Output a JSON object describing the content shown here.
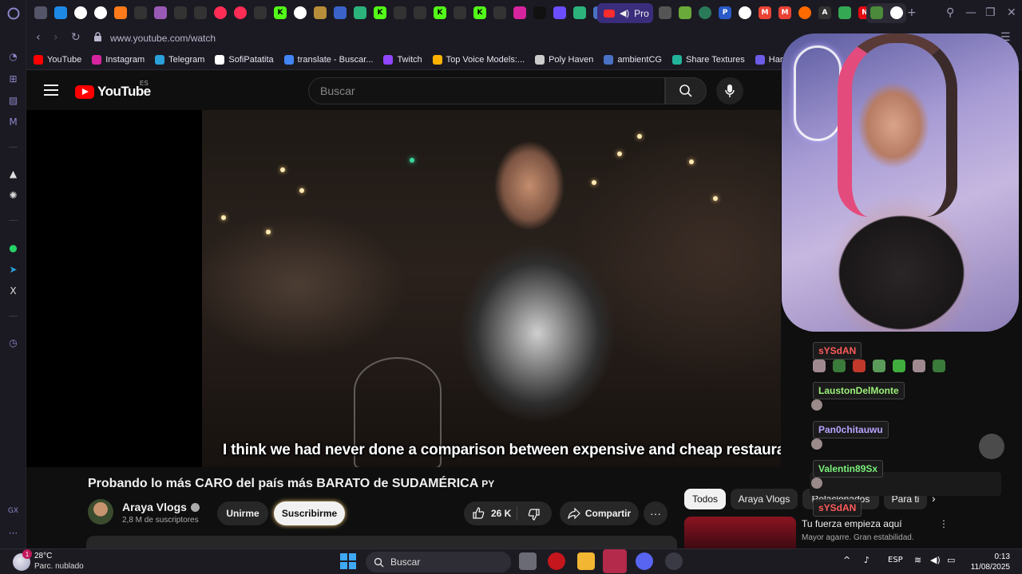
{
  "browser": {
    "url": "www.youtube.com/watch",
    "pro_tab_label": "Pro"
  },
  "bookmarks": [
    {
      "label": "YouTube",
      "color": "#ff0000"
    },
    {
      "label": "Instagram",
      "color": "#d6249f"
    },
    {
      "label": "Telegram",
      "color": "#2aa1da"
    },
    {
      "label": "SofiPatatita",
      "color": "#ffffff"
    },
    {
      "label": "translate - Buscar...",
      "color": "#4285f4"
    },
    {
      "label": "Twitch",
      "color": "#9146ff"
    },
    {
      "label": "Top Voice Models:...",
      "color": "#ffb300"
    },
    {
      "label": "Poly Haven",
      "color": "#cccccc"
    },
    {
      "label": "ambientCG",
      "color": "#4a72c4"
    },
    {
      "label": "Share Textures",
      "color": "#22b39a"
    },
    {
      "label": "Har",
      "color": "#6c5ce7"
    }
  ],
  "youtube": {
    "logo_text": "YouTube",
    "region": "ES",
    "search_placeholder": "Buscar",
    "subtitle": "I think we had never done a comparison between expensive and cheap restaurants,",
    "video_title": "Probando lo más CARO del país más BARATO de SUDAMÉRICA",
    "title_flag": "PY",
    "channel_name": "Araya Vlogs",
    "subscribers": "2,8 M de suscriptores",
    "join_label": "Unirme",
    "subscribe_label": "Suscribirme",
    "likes": "26 K",
    "share_label": "Compartir",
    "more_label": "···",
    "chips": [
      "Todos",
      "Araya Vlogs",
      "Relacionados",
      "Para ti"
    ],
    "rec_title": "Tu fuerza empieza aquí",
    "rec_subtitle": "Mayor agarre. Gran estabilidad."
  },
  "chat": [
    {
      "user": "sYSdAN",
      "color": "#ff5a5a"
    },
    {
      "user": "LaustonDelMonte",
      "color": "#9cf07a"
    },
    {
      "user": "Pan0chitauwu",
      "color": "#b8a4ff"
    },
    {
      "user": "Valentin89Sx",
      "color": "#7af07a"
    },
    {
      "user": "sYSdAN",
      "color": "#ff5a5a"
    }
  ],
  "taskbar": {
    "temperature": "28°C",
    "weather": "Parc. nublado",
    "weather_badge": "1",
    "search_label": "Buscar",
    "language": "ESP",
    "time": "0:13",
    "date": "11/08/2025"
  },
  "sidebar": {
    "gx_label": "GX"
  }
}
